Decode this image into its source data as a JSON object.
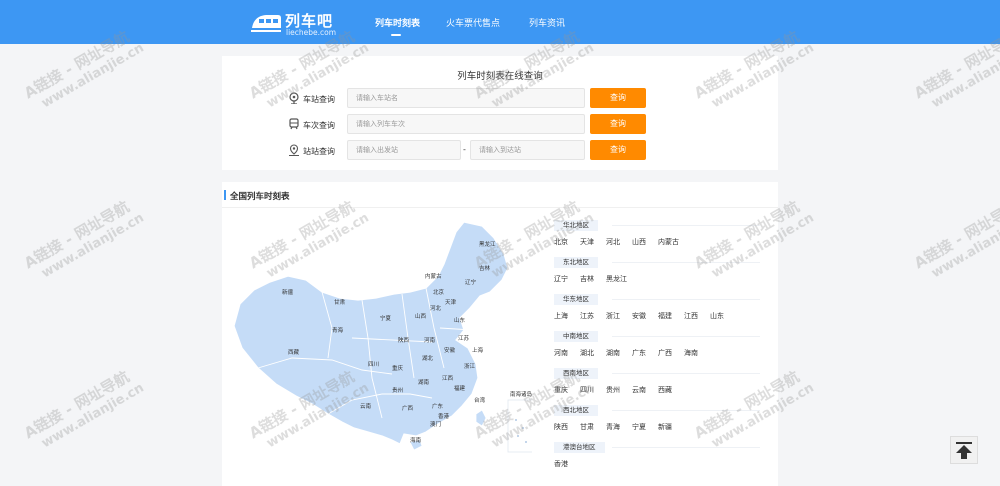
{
  "header": {
    "logo_name": "列车吧",
    "logo_domain": "liechebe.com",
    "nav": [
      "列车时刻表",
      "火车票代售点",
      "列车资讯"
    ]
  },
  "search": {
    "title": "列车时刻表在线查询",
    "station_label": "车站查询",
    "station_placeholder": "请输入车站名",
    "train_label": "车次查询",
    "train_placeholder": "请输入列车车次",
    "route_label": "站站查询",
    "from_placeholder": "请输入出发站",
    "dash": "-",
    "to_placeholder": "请输入到达站",
    "button": "查询"
  },
  "timetable": {
    "title": "全国列车时刻表",
    "map_provinces": [
      "黑龙江",
      "吉林",
      "辽宁",
      "内蒙古",
      "北京",
      "天津",
      "河北",
      "山西",
      "新疆",
      "甘肃",
      "宁夏",
      "青海",
      "陕西",
      "河南",
      "山东",
      "江苏",
      "安徽",
      "上海",
      "西藏",
      "四川",
      "湖北",
      "浙江",
      "重庆",
      "江西",
      "湖南",
      "福建",
      "贵州",
      "台湾",
      "云南",
      "广西",
      "广东",
      "香港",
      "澳门",
      "海南",
      "南海诸岛"
    ],
    "regions": [
      {
        "name": "华北地区",
        "cities": [
          "北京",
          "天津",
          "河北",
          "山西",
          "内蒙古"
        ]
      },
      {
        "name": "东北地区",
        "cities": [
          "辽宁",
          "吉林",
          "黑龙江"
        ]
      },
      {
        "name": "华东地区",
        "cities": [
          "上海",
          "江苏",
          "浙江",
          "安徽",
          "福建",
          "江西",
          "山东"
        ]
      },
      {
        "name": "中南地区",
        "cities": [
          "河南",
          "湖北",
          "湖南",
          "广东",
          "广西",
          "海南"
        ]
      },
      {
        "name": "西南地区",
        "cities": [
          "重庆",
          "四川",
          "贵州",
          "云南",
          "西藏"
        ]
      },
      {
        "name": "西北地区",
        "cities": [
          "陕西",
          "甘肃",
          "青海",
          "宁夏",
          "新疆"
        ]
      },
      {
        "name": "港澳台地区",
        "cities": [
          "香港"
        ]
      }
    ]
  },
  "watermark": {
    "line1": "A链接 - 网址导航",
    "line2": "www.alianjie.cn"
  },
  "colors": {
    "header": "#3d97f3",
    "button": "#ff8a00",
    "map_fill": "#c5dcf7"
  }
}
